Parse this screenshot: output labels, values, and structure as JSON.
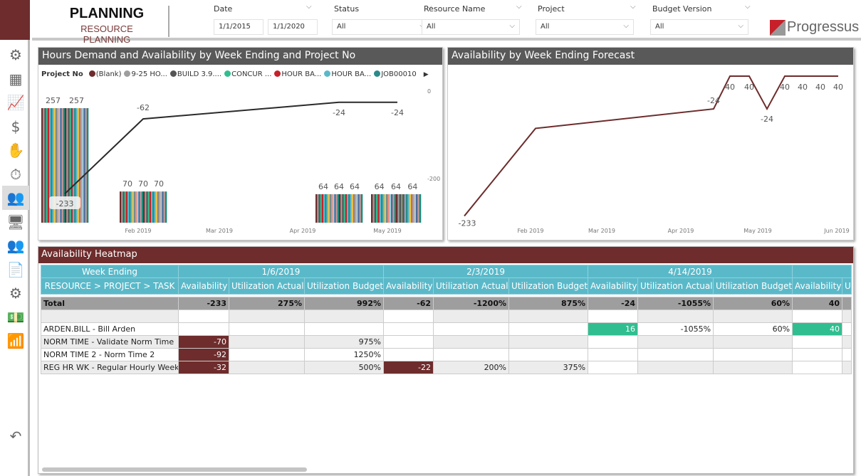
{
  "header": {
    "title": "PLANNING",
    "subtitle": "RESOURCE PLANNING",
    "logo": "Progressus"
  },
  "slicers": [
    {
      "label": "Date",
      "from": "1/1/2015",
      "to": "1/1/2020"
    },
    {
      "label": "Status",
      "value": "All"
    },
    {
      "label": "Resource Name",
      "value": "All"
    },
    {
      "label": "Project",
      "value": "All"
    },
    {
      "label": "Budget Version",
      "value": "All"
    }
  ],
  "sidebar": {
    "icons": [
      "settings-gear-icon",
      "dashboard-tablet-icon",
      "trend-chart-icon",
      "money-hands-icon",
      "hand-coins-icon",
      "stopwatch-icon",
      "resource-planning-icon",
      "monitor-gear-icon",
      "people-icon",
      "invoice-document-icon",
      "dollar-gear-icon",
      "cash-flow-icon",
      "growth-chart-icon",
      "back-arrow-icon"
    ],
    "active_index": 6
  },
  "colors": {
    "maroon": "#6e2c2c",
    "teal_header": "#5ab9c9",
    "positive": "#30be90",
    "panel_title": "#595959"
  },
  "chart_data": [
    {
      "type": "bar+line",
      "title": "Hours Demand and Availability by Week Ending and Project No",
      "legend_title": "Project No",
      "legend": [
        {
          "name": "(Blank)",
          "color": "#6e2c2c"
        },
        {
          "name": "9-25 HO...",
          "color": "#9e9e9e"
        },
        {
          "name": "BUILD 3.9....",
          "color": "#555555"
        },
        {
          "name": "CONCUR ...",
          "color": "#30be90"
        },
        {
          "name": "HOUR BA...",
          "color": "#c8202a"
        },
        {
          "name": "HOUR BA...",
          "color": "#5ab9c9"
        },
        {
          "name": "JOB00010",
          "color": "#2a8a8a"
        }
      ],
      "x_ticks": [
        "Feb 2019",
        "Mar 2019",
        "Apr 2019",
        "May 2019"
      ],
      "y2_ticks": [
        "0",
        "-200"
      ],
      "bar_groups": [
        {
          "labels": [
            "257",
            "257"
          ],
          "value": 257
        },
        {
          "labels": [
            "70",
            "70",
            "70"
          ],
          "value": 70
        },
        {
          "labels": [
            "64",
            "64",
            "64"
          ],
          "value": 64
        },
        {
          "labels": [
            "64",
            "64",
            "64"
          ],
          "value": 64
        }
      ],
      "line": {
        "values": [
          -233,
          -62,
          -24,
          -24
        ],
        "labels": [
          "-233",
          "-62",
          "-24",
          "-24"
        ]
      }
    },
    {
      "type": "line",
      "title": "Availability by Week Ending Forecast",
      "x_ticks": [
        "Feb 2019",
        "Mar 2019",
        "Apr 2019",
        "May 2019",
        "Jun 2019"
      ],
      "values": [
        -233,
        -62,
        -24,
        40,
        40,
        -24,
        40,
        40,
        40,
        40
      ],
      "labels": [
        "-233",
        "",
        "-24",
        "40",
        "40",
        "-24",
        "40",
        "40",
        "40",
        "40"
      ],
      "color": "#6e2c2c"
    }
  ],
  "heatmap": {
    "title": "Availability Heatmap",
    "row_header_top": "Week Ending",
    "row_header": "RESOURCE > PROJECT > TASK",
    "weeks": [
      "1/6/2019",
      "2/3/2019",
      "4/14/2019",
      ""
    ],
    "measures": [
      "Availability",
      "Utilization Actual",
      "Utilization Budget"
    ],
    "total": {
      "label": "Total",
      "values": [
        "-233",
        "275%",
        "992%",
        "-62",
        "-1200%",
        "875%",
        "-24",
        "-1055%",
        "60%",
        "40",
        ""
      ]
    },
    "rows": [
      {
        "label": "",
        "values": [
          "",
          "",
          "",
          "",
          "",
          "",
          "",
          "",
          "",
          "",
          ""
        ]
      },
      {
        "label": "ARDEN.BILL - Bill Arden",
        "values": [
          "",
          "",
          "",
          "",
          "",
          "",
          "16",
          "-1055%",
          "60%",
          "40",
          ""
        ]
      },
      {
        "label": "NORM TIME - Validate Norm Time",
        "values": [
          "-70",
          "",
          "975%",
          "",
          "",
          "",
          "",
          "",
          "",
          "",
          ""
        ]
      },
      {
        "label": "NORM TIME 2 - Norm Time 2",
        "values": [
          "-92",
          "",
          "1250%",
          "",
          "",
          "",
          "",
          "",
          "",
          "",
          ""
        ]
      },
      {
        "label": "REG HR WK - Regular Hourly Weekly",
        "values": [
          "-32",
          "",
          "500%",
          "-22",
          "200%",
          "375%",
          "",
          "",
          "",
          "",
          ""
        ]
      }
    ]
  }
}
